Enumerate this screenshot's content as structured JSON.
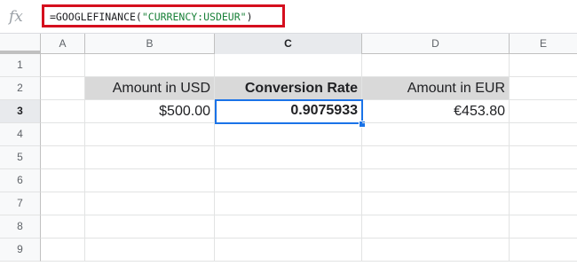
{
  "formula_bar": {
    "icon": "fx-icon",
    "prefix": "=GOOGLEFINANCE(",
    "string_arg": "\"CURRENCY:USDEUR\"",
    "suffix": ")"
  },
  "columns": [
    "A",
    "B",
    "C",
    "D",
    "E"
  ],
  "rows": [
    "1",
    "2",
    "3",
    "4",
    "5",
    "6",
    "7",
    "8",
    "9"
  ],
  "cells": {
    "B2": "Amount in USD",
    "C2": "Conversion Rate",
    "D2": "Amount in EUR",
    "B3": "$500.00",
    "C3": "0.9075933",
    "D3": "€453.80"
  },
  "colors": {
    "formula_highlight": "#d50f1e",
    "string_literal": "#188038",
    "selection": "#1a73e8",
    "header_fill": "#d9d9d9"
  }
}
